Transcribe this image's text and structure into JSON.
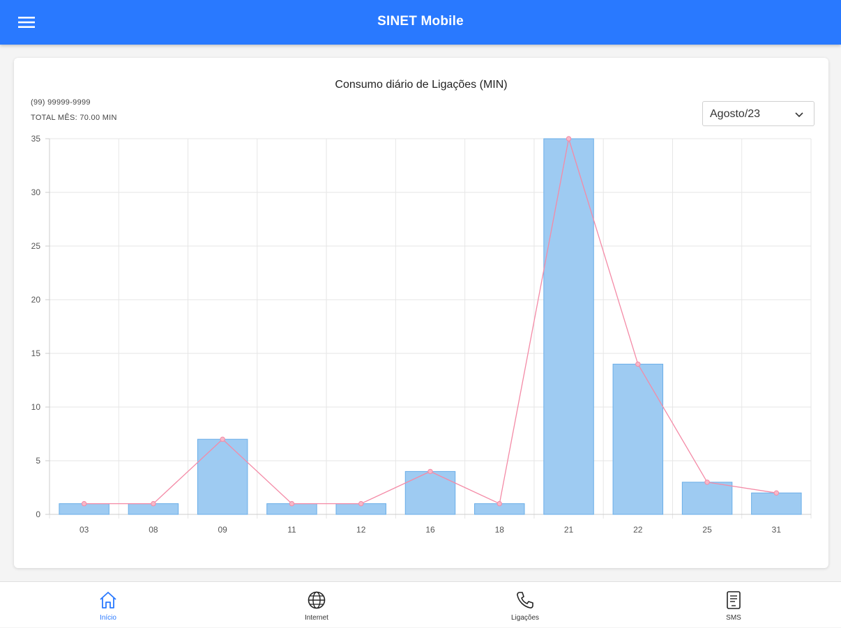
{
  "app": {
    "title": "SINET Mobile",
    "accent_color": "#2979ff"
  },
  "menu": {
    "icon": "menu-icon"
  },
  "card": {
    "phone": "(99) 99999-9999",
    "total": "TOTAL MÊS: 70.00 MIN",
    "month_select": {
      "value": "Agosto/23",
      "icon": "chevron-down-icon"
    }
  },
  "chart_data": {
    "type": "bar",
    "title": "Consumo diário de Ligações (MIN)",
    "categories": [
      "03",
      "08",
      "09",
      "11",
      "12",
      "16",
      "18",
      "21",
      "22",
      "25",
      "31"
    ],
    "series": [
      {
        "type": "bar",
        "values": [
          1,
          1,
          7,
          1,
          1,
          4,
          1,
          35,
          14,
          3,
          2
        ],
        "color": "#9ecbf2",
        "border_color": "#6aaee8"
      },
      {
        "type": "line",
        "values": [
          1,
          1,
          7,
          1,
          1,
          4,
          1,
          35,
          14,
          3,
          2
        ],
        "color": "#f48aa6"
      }
    ],
    "ylim": [
      0,
      35
    ],
    "yticks": [
      "0",
      "5",
      "10",
      "15",
      "20",
      "25",
      "30",
      "35"
    ],
    "grid": true
  },
  "bottom_nav": [
    {
      "label": "Início",
      "icon": "home-icon",
      "active": true
    },
    {
      "label": "Internet",
      "icon": "globe-icon",
      "active": false
    },
    {
      "label": "Ligações",
      "icon": "phone-icon",
      "active": false
    },
    {
      "label": "SMS",
      "icon": "sms-icon",
      "active": false
    }
  ]
}
